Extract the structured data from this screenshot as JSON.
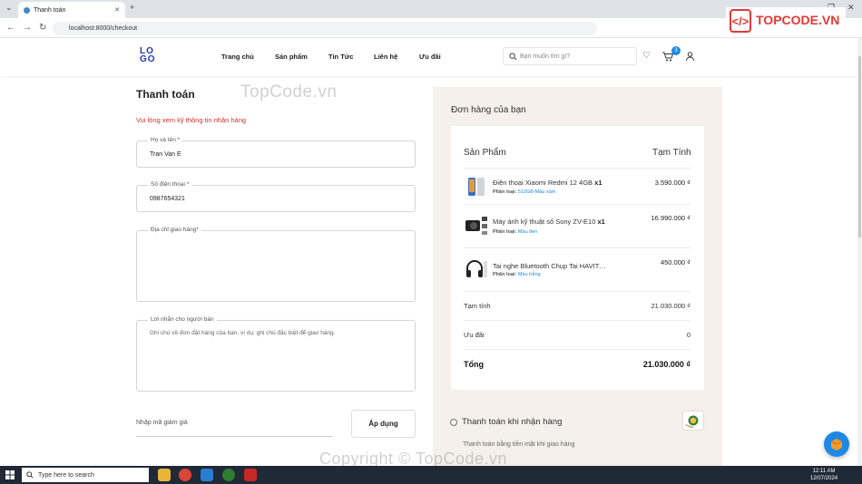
{
  "browser": {
    "tab_title": "Thanh toán",
    "url": "localhost:8000/checkout"
  },
  "header": {
    "logo_top": "LO",
    "logo_bottom": "GO",
    "menu": [
      "Trang chủ",
      "Sản phẩm",
      "Tin Tức",
      "Liên hệ",
      "Ưu đãi"
    ],
    "search_placeholder": "Bạn muốn tìm gì?",
    "cart_count": "3"
  },
  "checkout": {
    "title": "Thanh toán",
    "warning": "Vui lòng xem kỹ thông tin nhận hàng",
    "fields": {
      "name_label": "Họ và tên *",
      "name_value": "Tran Van E",
      "phone_label": "Số điện thoại *",
      "phone_value": "0987654321",
      "address_label": "Địa chỉ giao hàng*",
      "note_label": "Lời nhắn cho người bán",
      "note_placeholder": "Ghi chú về đơn đặt hàng của bạn, ví dụ: ghi chú đặc biệt để giao hàng."
    },
    "coupon_placeholder": "Nhập mã giảm giá",
    "apply_label": "Áp dụng"
  },
  "order": {
    "title": "Đơn hàng của bạn",
    "col_product": "Sản Phẩm",
    "col_subtotal": "Tạm Tính",
    "items": [
      {
        "name": "Điện thoại Xiaomi Redmi 12 4GB",
        "qty": "x1",
        "variant_label": "Phân loại:",
        "variant": "512GB-Màu xám",
        "price": "3.590.000 ₫"
      },
      {
        "name": "Máy ảnh kỹ thuật số Sony ZV-E10",
        "qty": "x1",
        "variant_label": "Phân loại:",
        "variant": "Màu đen",
        "price": "16.990.000 ₫"
      },
      {
        "name": "Tai nghe Bluetooth Chụp Tai HAVIT…",
        "qty": "",
        "variant_label": "Phân loại:",
        "variant": "Màu trắng",
        "price": "450.000 ₫"
      }
    ],
    "subtotal_label": "Tạm tính",
    "subtotal_value": "21.030.000 ₫",
    "discount_label": "Ưu đãi",
    "discount_value": "0",
    "total_label": "Tổng",
    "total_value": "21.030.000 ₫"
  },
  "payment": {
    "option_label": "Thanh toán khi nhận hàng",
    "option_desc": "Thanh toán bằng tiền mặt khi giao hàng"
  },
  "watermark": {
    "top": "TopCode.vn",
    "bottom": "Copyright © TopCode.vn",
    "brand": "TOPCODE.VN"
  },
  "taskbar": {
    "search_placeholder": "Type here to search",
    "time": "12:11 AM",
    "date": "12/07/2024"
  }
}
